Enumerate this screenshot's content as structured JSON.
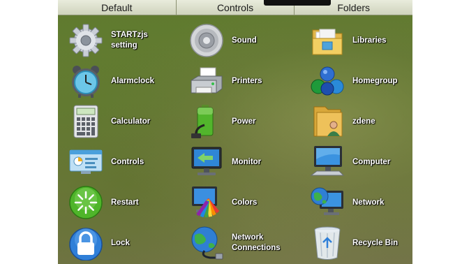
{
  "tabs": [
    "Default",
    "Controls",
    "Folders"
  ],
  "items": [
    {
      "label": "STARTzjs\nsetting",
      "icon": "gear-icon"
    },
    {
      "label": "Sound",
      "icon": "speaker-icon"
    },
    {
      "label": "Libraries",
      "icon": "libraries-folder-icon"
    },
    {
      "label": "Alarmclock",
      "icon": "alarm-clock-icon"
    },
    {
      "label": "Printers",
      "icon": "printer-icon"
    },
    {
      "label": "Homegroup",
      "icon": "homegroup-icon"
    },
    {
      "label": "Calculator",
      "icon": "calculator-icon"
    },
    {
      "label": "Power",
      "icon": "battery-plug-icon"
    },
    {
      "label": "zdene",
      "icon": "user-folder-icon"
    },
    {
      "label": "Controls",
      "icon": "control-panel-icon"
    },
    {
      "label": "Monitor",
      "icon": "monitor-icon"
    },
    {
      "label": "Computer",
      "icon": "computer-icon"
    },
    {
      "label": "Restart",
      "icon": "restart-icon"
    },
    {
      "label": "Colors",
      "icon": "colors-icon"
    },
    {
      "label": "Network",
      "icon": "network-icon"
    },
    {
      "label": "Lock",
      "icon": "lock-icon"
    },
    {
      "label": "Network\nConnections",
      "icon": "network-connections-icon"
    },
    {
      "label": "Recycle Bin",
      "icon": "recycle-bin-icon"
    }
  ]
}
